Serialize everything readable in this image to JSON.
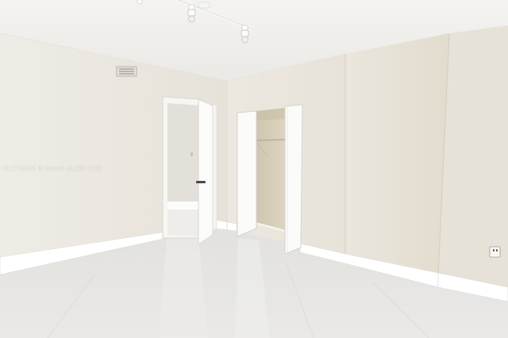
{
  "photo": {
    "watermark": "A11779524 © Miami MLS® 2025"
  },
  "colors": {
    "ceiling": "#f1f0ee",
    "wall_left": "#ebe8e1",
    "wall_center": "#e9e5dc",
    "wall_right": "#e4dfd4",
    "floor": "#e5e4e2",
    "baseboard": "#ffffff",
    "closet_interior": "#d6cdb8"
  }
}
